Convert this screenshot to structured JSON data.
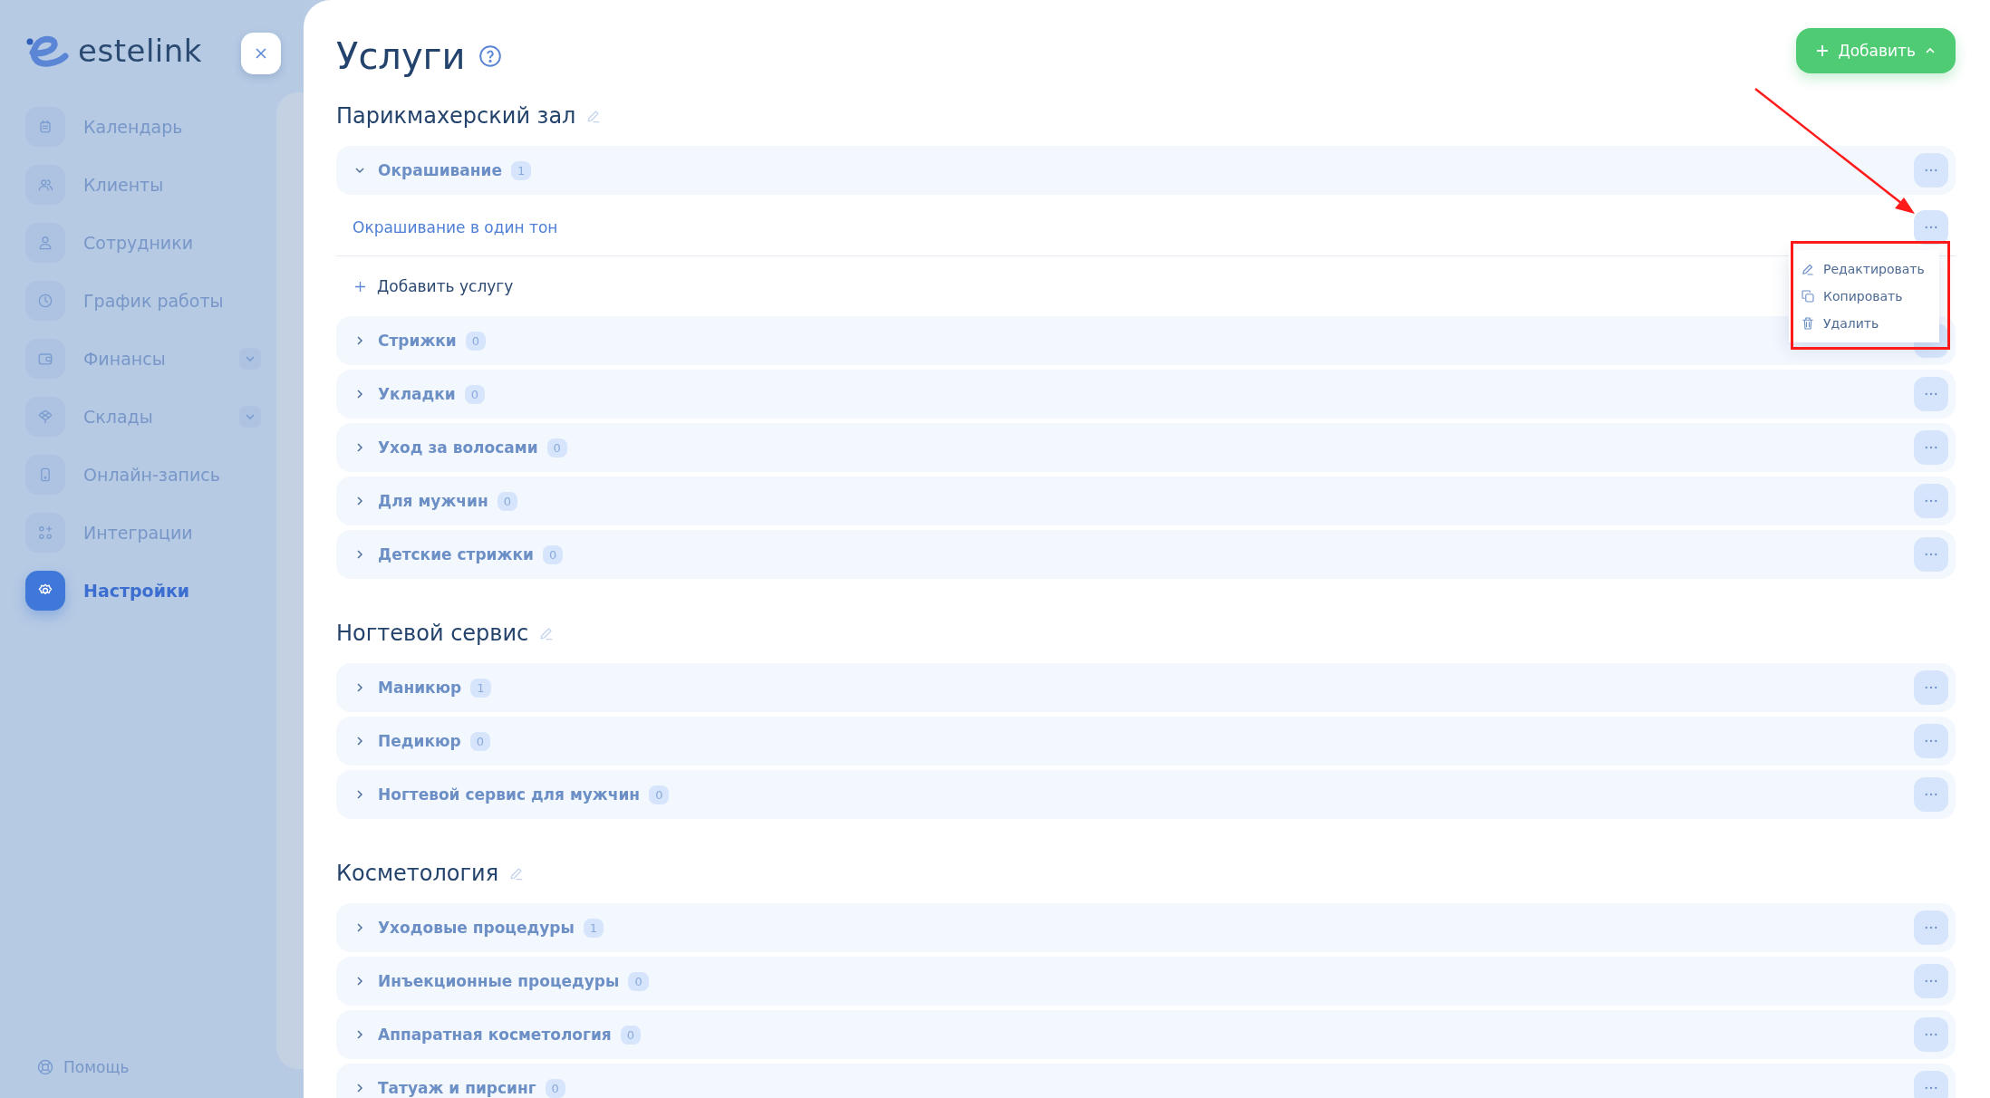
{
  "sidebar": {
    "logo": "estelink",
    "items": [
      {
        "label": "Календарь",
        "kind": "calendar",
        "expandable": false,
        "selected": false
      },
      {
        "label": "Клиенты",
        "kind": "clients",
        "expandable": false,
        "selected": false
      },
      {
        "label": "Сотрудники",
        "kind": "staff",
        "expandable": false,
        "selected": false
      },
      {
        "label": "График работы",
        "kind": "schedule",
        "expandable": false,
        "selected": false
      },
      {
        "label": "Финансы",
        "kind": "finance",
        "expandable": true,
        "selected": false
      },
      {
        "label": "Склады",
        "kind": "stock",
        "expandable": true,
        "selected": false
      },
      {
        "label": "Онлайн-запись",
        "kind": "booking",
        "expandable": false,
        "selected": false
      },
      {
        "label": "Интеграции",
        "kind": "integrations",
        "expandable": false,
        "selected": false
      },
      {
        "label": "Настройки",
        "kind": "settings",
        "expandable": false,
        "selected": true
      }
    ],
    "help": "Помощь"
  },
  "page": {
    "title": "Услуги",
    "add_button": "Добавить"
  },
  "sections": [
    {
      "title": "Парикмахерский зал",
      "categories": [
        {
          "name": "Окрашивание",
          "count": "1",
          "expanded": true,
          "services": [
            {
              "name": "Окрашивание в один тон",
              "menu": {
                "items": [
                  {
                    "label": "Редактировать",
                    "kind": "edit"
                  },
                  {
                    "label": "Копировать",
                    "kind": "copy"
                  },
                  {
                    "label": "Удалить",
                    "kind": "delete"
                  }
                ]
              }
            }
          ],
          "add_service": "Добавить услугу"
        },
        {
          "name": "Стрижки",
          "count": "0",
          "expanded": false
        },
        {
          "name": "Укладки",
          "count": "0",
          "expanded": false
        },
        {
          "name": "Уход за волосами",
          "count": "0",
          "expanded": false
        },
        {
          "name": "Для мужчин",
          "count": "0",
          "expanded": false
        },
        {
          "name": "Детские стрижки",
          "count": "0",
          "expanded": false
        }
      ]
    },
    {
      "title": "Ногтевой сервис",
      "categories": [
        {
          "name": "Маникюр",
          "count": "1",
          "expanded": false
        },
        {
          "name": "Педикюр",
          "count": "0",
          "expanded": false
        },
        {
          "name": "Ногтевой сервис для мужчин",
          "count": "0",
          "expanded": false
        }
      ]
    },
    {
      "title": "Косметология",
      "categories": [
        {
          "name": "Уходовые процедуры",
          "count": "1",
          "expanded": false
        },
        {
          "name": "Инъекционные процедуры",
          "count": "0",
          "expanded": false
        },
        {
          "name": "Аппаратная косметология",
          "count": "0",
          "expanded": false
        },
        {
          "name": "Татуаж и пирсинг",
          "count": "0",
          "expanded": false
        }
      ]
    }
  ]
}
